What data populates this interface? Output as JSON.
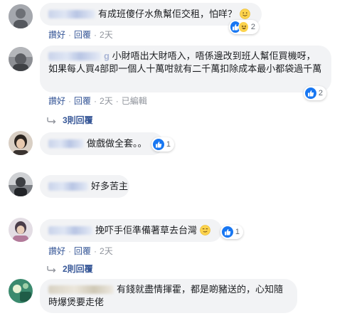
{
  "labels": {
    "like": "讚好",
    "reply": "回覆",
    "dot": "·"
  },
  "comments": [
    {
      "name": "",
      "text": "有成班傻仔水魚幫佢交租，怕咩？",
      "time": "2天",
      "reactions": {
        "count": "2",
        "types": [
          "like-icon",
          "haha-icon"
        ]
      }
    },
    {
      "name": "g",
      "text": "小財唔出大財唔入，唔係邊改到班人幫佢買機呀，如果每人買4部即一個人十萬咁就有二千萬扣除成本最小都袋過千萬",
      "time": "2天",
      "edited": "已編輯",
      "reactions": {
        "count": "2",
        "types": [
          "like-icon"
        ]
      },
      "replies": "3則回覆"
    },
    {
      "name": "",
      "text": "做戲做全套。。",
      "time": "",
      "reactions": {
        "count": "1",
        "types": [
          "like-icon"
        ]
      }
    },
    {
      "name": "",
      "text": "好多苦主",
      "time": ""
    },
    {
      "name": "",
      "text": "挽吓手佢準備著草去台灣",
      "time": "2天",
      "reactions": {
        "count": "1",
        "types": [
          "like-icon"
        ]
      },
      "replies": "2則回覆"
    },
    {
      "name": "",
      "text": "有錢就盡情揮霍，都是啲豬送的，心知隨時爆煲要走佬",
      "time": ""
    }
  ]
}
